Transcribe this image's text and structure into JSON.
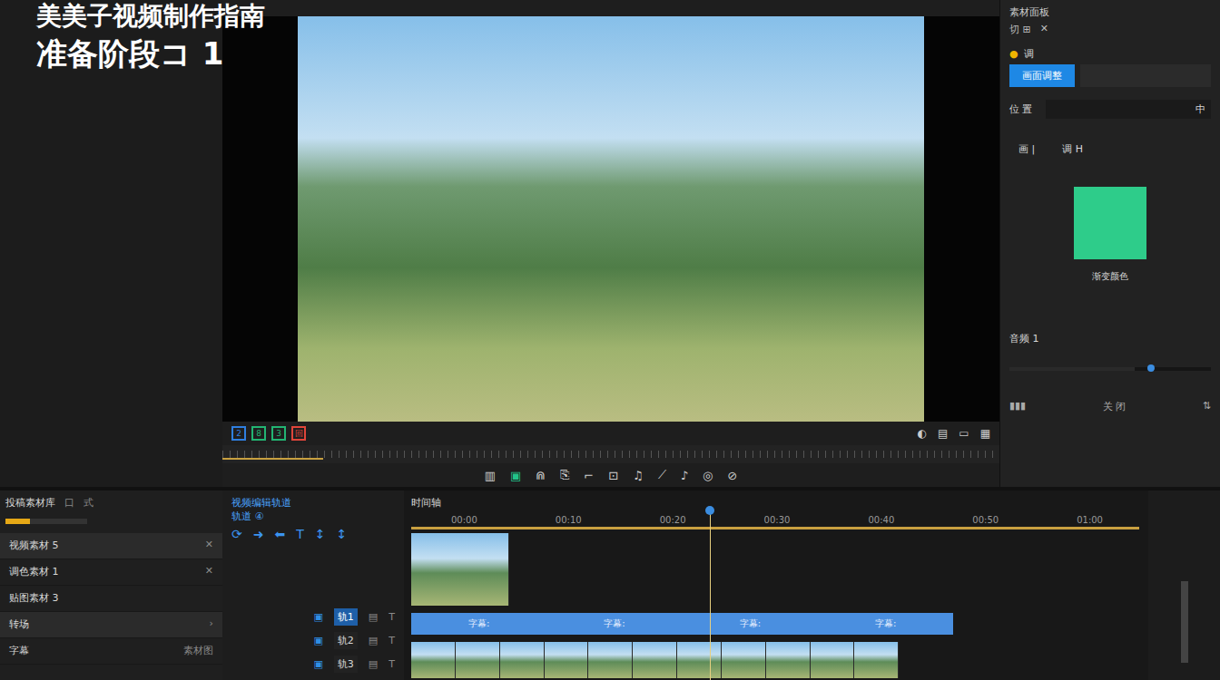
{
  "overlay": {
    "title": "美美子视频制作指南",
    "subtitle": "准备阶段コ 1"
  },
  "preview": {
    "marks": [
      {
        "label": "2",
        "color": "#2f7fe0"
      },
      {
        "label": "8",
        "color": "#22b573"
      },
      {
        "label": "3",
        "color": "#22b573"
      },
      {
        "label": "回",
        "color": "#e0453a"
      }
    ],
    "right_icons": [
      "◐",
      "▤",
      "▭",
      "▦"
    ],
    "toolbar": [
      "▥",
      "▣",
      "⋒",
      "⎘",
      "⌐",
      "⊡",
      "♫",
      "⟋",
      "♪",
      "◎",
      "⊘"
    ],
    "toolbar_active": 1,
    "scrub_level": 0.13
  },
  "right_panel": {
    "header": "素材面板",
    "tabs": [
      "切 ⊞",
      "✕"
    ],
    "badge": "调",
    "active_button": "画面调整",
    "field_label": "位 置",
    "field_icon": "中",
    "pair": [
      "画 |",
      "调 H"
    ],
    "swatch_color": "#2ecc8a",
    "swatch_label": "渐变颜色",
    "slider_label": "音频 1",
    "slider_level": 0.62,
    "footer": [
      "▮▮▮",
      "关 闭",
      "⇅"
    ]
  },
  "library": {
    "header": "投稿素材库",
    "header_icons": [
      "口",
      "式"
    ],
    "level": 0.3,
    "items": [
      {
        "label": "视频素材 5",
        "selected": true,
        "end": "✕"
      },
      {
        "label": "调色素材 1",
        "selected": false,
        "end": "✕"
      },
      {
        "label": "贴图素材 3",
        "selected": false,
        "end": ""
      },
      {
        "label": "转场",
        "selected": true,
        "end": "›"
      },
      {
        "label": "字幕",
        "selected": false,
        "end": "素材图"
      }
    ]
  },
  "tracks_panel": {
    "title": "视频编辑轨道",
    "subtitle": "轨道 ④",
    "tools": [
      "⟳",
      "➜",
      "⬅",
      "T",
      "↕",
      "↕"
    ],
    "rows": [
      {
        "badge": "▣",
        "label": "轨1",
        "icons": [
          "▤",
          "T"
        ],
        "selected": true
      },
      {
        "badge": "▣",
        "label": "轨2",
        "icons": [
          "▤",
          "T"
        ],
        "selected": false
      },
      {
        "badge": "▣",
        "label": "轨3",
        "icons": [
          "▤",
          "T"
        ],
        "selected": false
      }
    ]
  },
  "timeline": {
    "title": "时间轴",
    "ruler": [
      "00:00",
      "00:10",
      "00:20",
      "00:30",
      "00:40",
      "00:50",
      "01:00"
    ],
    "playhead": 0.41,
    "caption_track": {
      "length": 0.745,
      "labels": [
        "字幕:",
        "字幕:",
        "字幕:",
        "字幕:"
      ]
    },
    "thumb_track": {
      "length": 0.67,
      "count": 11
    },
    "main_clip": {
      "length": 0.135
    }
  }
}
